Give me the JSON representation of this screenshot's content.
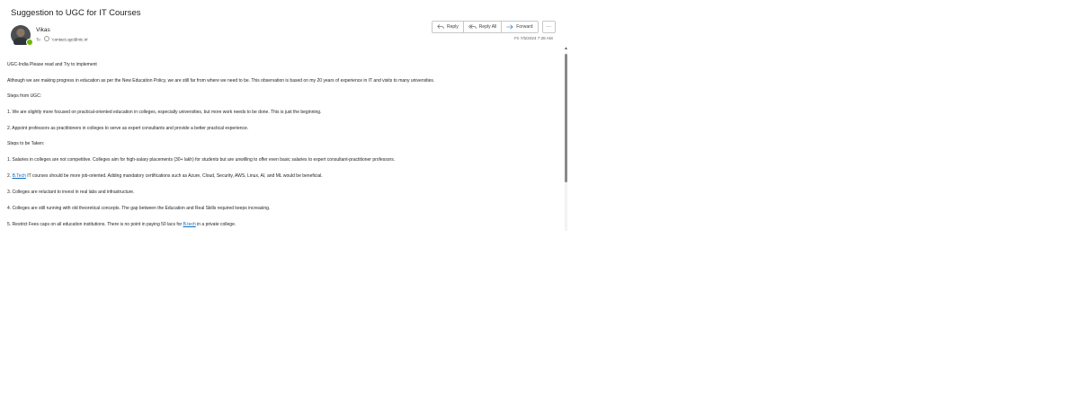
{
  "email": {
    "subject": "Suggestion to UGC for IT Courses",
    "sender": "Vikas",
    "to_label": "To",
    "to_address": "'contact.ugc@nic.in'",
    "timestamp": "Fri 7/5/2024 7:28 AM",
    "presence_color": "#6bb700"
  },
  "actions": {
    "reply": "Reply",
    "reply_all": "Reply All",
    "forward": "Forward",
    "more": "···",
    "reply_icon": "reply-icon",
    "reply_all_icon": "reply-all-icon",
    "forward_icon": "forward-icon"
  },
  "body": {
    "p0": "UGC-India  Please read and Try to implement",
    "p1": "Although we are making progress in education as per the New Education Policy, we are still far from where we need to be. This observation is based on my 20 years of experience in IT and visits to many universities.",
    "p2": "Steps from UGC:",
    "p3": "1. We are slightly more focused on practical-oriented education in colleges, especially universities, but more work needs to be done. This is just the beginning.",
    "p4": "2. Appoint professors as practitioners in colleges to serve as expert consultants and provide a better practical experience.",
    "p5": "Steps to be Taken:",
    "p6": "1. Salaries in colleges are not competitive. Colleges aim for high-salary placements (30+ lakh) for students but are unwilling to offer even basic salaries to expert consultant-practitioner professors.",
    "p7_prefix": "2. ",
    "p7_link": "B.Tech",
    "p7_suffix": " IT courses should be more job-oriented. Adding mandatory certifications such as Azure, Cloud, Security, AWS, Linux, AI, and ML would be beneficial.",
    "p8": "3. Colleges are reluctant to invest in real labs and infrastructure.",
    "p9": "4. Colleges are still running with old theoretical concepts. The gap between the Education and Real Skills required keeps increasing.",
    "p10_prefix": "5. Restrict Fees caps on all education institutions. There is no point in paying 50 lacs for ",
    "p10_link": "B.tech",
    "p10_suffix": " in a private college."
  },
  "colors": {
    "link": "#0f6cbd",
    "text": "#242424",
    "muted": "#616161"
  }
}
